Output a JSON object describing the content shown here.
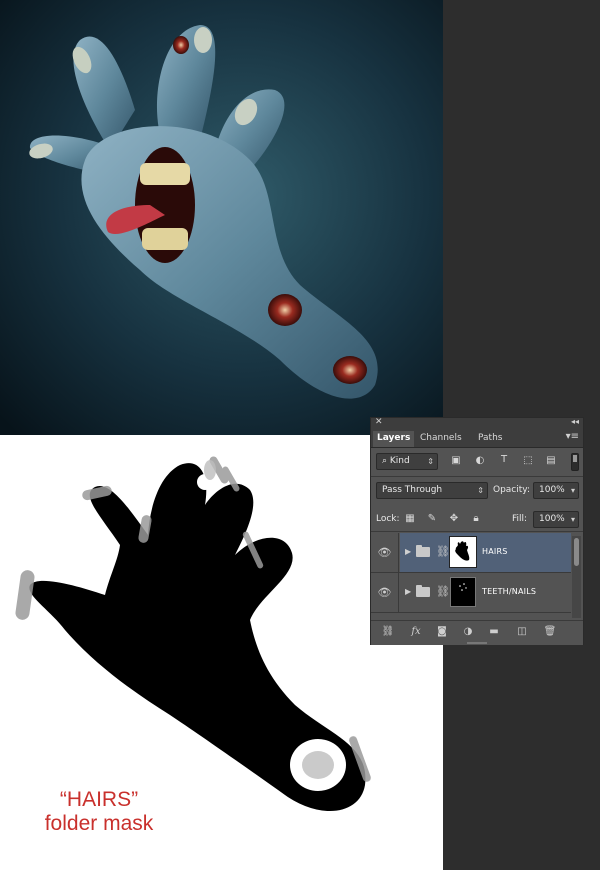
{
  "caption": {
    "line1": "“HAIRS”",
    "line2": "folder mask"
  },
  "colors": {
    "caption_red": "#c9302c",
    "panel_bg": "#535353",
    "selected_row": "#516178",
    "dark_bg": "#2d2d2d"
  },
  "layers_panel": {
    "close_icon": "close-icon",
    "tabs": [
      "Layers",
      "Channels",
      "Paths"
    ],
    "active_tab": "Layers",
    "filter": {
      "search_icon": "search-icon",
      "kind_label": "Kind",
      "filter_icons": [
        "image-icon",
        "adjustment-icon",
        "type-icon",
        "shape-icon",
        "smart-object-icon"
      ]
    },
    "blend_mode": "Pass Through",
    "opacity_label": "Opacity:",
    "opacity_value": "100%",
    "lock_label": "Lock:",
    "fill_label": "Fill:",
    "fill_value": "100%",
    "layers": [
      {
        "name": "HAIRS",
        "type": "folder",
        "visible": true,
        "selected": true,
        "mask": "white"
      },
      {
        "name": "TEETH/NAILS",
        "type": "folder",
        "visible": true,
        "selected": false,
        "mask": "black"
      }
    ],
    "bottom_icons": [
      "link-icon",
      "fx-icon",
      "add-mask-icon",
      "adjustment-layer-icon",
      "new-group-icon",
      "new-layer-icon",
      "trash-icon"
    ]
  }
}
